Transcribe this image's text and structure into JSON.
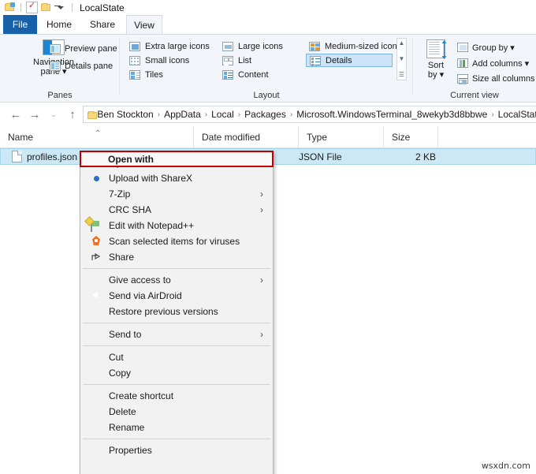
{
  "window": {
    "title": "LocalState",
    "quick_access": [
      {
        "name": "properties-icon",
        "label": "Properties"
      },
      {
        "name": "new-folder-checkbox-icon",
        "label": "Check"
      },
      {
        "name": "new-folder-icon",
        "label": "New folder"
      },
      {
        "name": "customize-quick-access-icon",
        "label": "Customize Quick Access Toolbar"
      }
    ]
  },
  "tabs": [
    {
      "id": "file",
      "label": "File"
    },
    {
      "id": "home",
      "label": "Home"
    },
    {
      "id": "share",
      "label": "Share"
    },
    {
      "id": "view",
      "label": "View"
    }
  ],
  "ribbon": {
    "panes": {
      "group_label": "Panes",
      "navigation_pane": {
        "line1": "Navigation",
        "line2": "pane ▾"
      },
      "preview_pane": "Preview pane",
      "details_pane": "Details pane"
    },
    "layout": {
      "group_label": "Layout",
      "items": [
        {
          "label": "Extra large icons",
          "selected": false
        },
        {
          "label": "Large icons",
          "selected": false
        },
        {
          "label": "Medium-sized icons",
          "selected": false
        },
        {
          "label": "Small icons",
          "selected": false
        },
        {
          "label": "List",
          "selected": false
        },
        {
          "label": "Details",
          "selected": true
        },
        {
          "label": "Tiles",
          "selected": false
        },
        {
          "label": "Content",
          "selected": false
        }
      ],
      "scroll_up": "▲",
      "scroll_down": "▼",
      "scroll_more": "☰"
    },
    "current_view": {
      "group_label": "Current view",
      "sort_by": {
        "line1": "Sort",
        "line2": "by ▾"
      },
      "group_by": "Group by ▾",
      "add_columns": "Add columns ▾",
      "size_all_columns": "Size all columns to f"
    }
  },
  "address_bar": {
    "back": "←",
    "forward": "→",
    "recent": "⌄",
    "up": "↑",
    "breadcrumbs": [
      "Ben Stockton",
      "AppData",
      "Local",
      "Packages",
      "Microsoft.WindowsTerminal_8wekyb3d8bbwe",
      "LocalState"
    ],
    "separator": "›"
  },
  "columns": [
    {
      "label": "Name",
      "sorted": true,
      "sort_glyph": "⌃"
    },
    {
      "label": "Date modified",
      "sorted": false,
      "sort_glyph": ""
    },
    {
      "label": "Type",
      "sorted": false,
      "sort_glyph": ""
    },
    {
      "label": "Size",
      "sorted": false,
      "sort_glyph": ""
    }
  ],
  "files": [
    {
      "name": "profiles.json",
      "date_modified": "",
      "type": "JSON File",
      "size": "2 KB",
      "selected": true
    }
  ],
  "context_menu": {
    "highlight_color": "#c00000",
    "items": [
      {
        "label": "Open with",
        "bold": true,
        "icon": "",
        "submenu": false,
        "highlighted": true
      },
      {
        "label": "Upload with ShareX",
        "bold": false,
        "icon": "sharex-icon",
        "submenu": false
      },
      {
        "label": "7-Zip",
        "bold": false,
        "icon": "",
        "submenu": true
      },
      {
        "label": "CRC SHA",
        "bold": false,
        "icon": "",
        "submenu": true
      },
      {
        "label": "Edit with Notepad++",
        "bold": false,
        "icon": "notepadpp-icon",
        "submenu": false
      },
      {
        "label": "Scan selected items for viruses",
        "bold": false,
        "icon": "avast-icon",
        "submenu": false
      },
      {
        "label": "Share",
        "bold": false,
        "icon": "share-icon",
        "submenu": false
      },
      {
        "separator": true
      },
      {
        "label": "Give access to",
        "bold": false,
        "icon": "",
        "submenu": true
      },
      {
        "label": "Send via AirDroid",
        "bold": false,
        "icon": "airdroid-icon",
        "submenu": false
      },
      {
        "label": "Restore previous versions",
        "bold": false,
        "icon": "",
        "submenu": false
      },
      {
        "separator": true
      },
      {
        "label": "Send to",
        "bold": false,
        "icon": "",
        "submenu": true
      },
      {
        "separator": true
      },
      {
        "label": "Cut",
        "bold": false,
        "icon": "",
        "submenu": false
      },
      {
        "label": "Copy",
        "bold": false,
        "icon": "",
        "submenu": false
      },
      {
        "separator": true
      },
      {
        "label": "Create shortcut",
        "bold": false,
        "icon": "",
        "submenu": false
      },
      {
        "label": "Delete",
        "bold": false,
        "icon": "",
        "submenu": false
      },
      {
        "label": "Rename",
        "bold": false,
        "icon": "",
        "submenu": false
      },
      {
        "separator": true
      },
      {
        "label": "Properties",
        "bold": false,
        "icon": "",
        "submenu": false
      }
    ],
    "submenu_arrow": "›"
  },
  "watermark": "wsxdn.com"
}
